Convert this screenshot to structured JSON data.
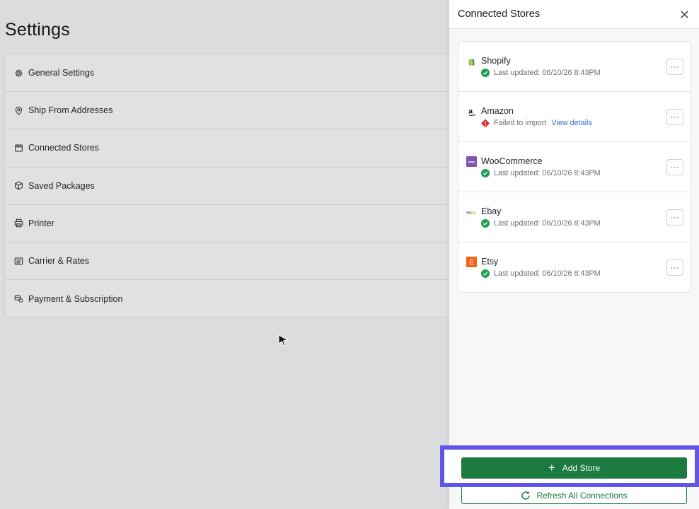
{
  "settings": {
    "title": "Settings",
    "items": [
      {
        "label": "General Settings",
        "icon": "gear-icon"
      },
      {
        "label": "Ship From Addresses",
        "icon": "map-pin-icon"
      },
      {
        "label": "Connected Stores",
        "icon": "store-icon"
      },
      {
        "label": "Saved Packages",
        "icon": "package-icon"
      },
      {
        "label": "Printer",
        "icon": "printer-icon"
      },
      {
        "label": "Carrier & Rates",
        "icon": "list-icon"
      },
      {
        "label": "Payment & Subscription",
        "icon": "payment-icon"
      }
    ]
  },
  "drawer": {
    "title": "Connected Stores",
    "stores": [
      {
        "name": "Shopify",
        "status": "Last updated: 06/10/26 8:43PM",
        "state": "success",
        "logo": "shopify-logo-icon"
      },
      {
        "name": "Amazon",
        "status": "Failed to import",
        "state": "error",
        "link": "View details",
        "logo": "amazon-logo-icon"
      },
      {
        "name": "WooCommerce",
        "status": "Last updated: 06/10/26 8:43PM",
        "state": "success",
        "logo": "woocommerce-logo-icon",
        "logo_text": "woo"
      },
      {
        "name": "Ebay",
        "status": "Last updated: 06/10/26 8:43PM",
        "state": "success",
        "logo": "ebay-logo-icon",
        "logo_text": "ebay"
      },
      {
        "name": "Etsy",
        "status": "Last updated: 06/10/26 8:43PM",
        "state": "success",
        "logo": "etsy-logo-icon",
        "logo_text": "E"
      }
    ],
    "more_label": "···",
    "add_store_label": "Add Store",
    "refresh_label": "Refresh All Connections"
  },
  "colors": {
    "primary_green": "#1b7a3d",
    "success_green": "#1f9d55",
    "error_red": "#d62b2b",
    "link_blue": "#2f6fd6",
    "highlight": "#6055e8",
    "woo_purple": "#7f54b3",
    "etsy_orange": "#f1641e"
  }
}
